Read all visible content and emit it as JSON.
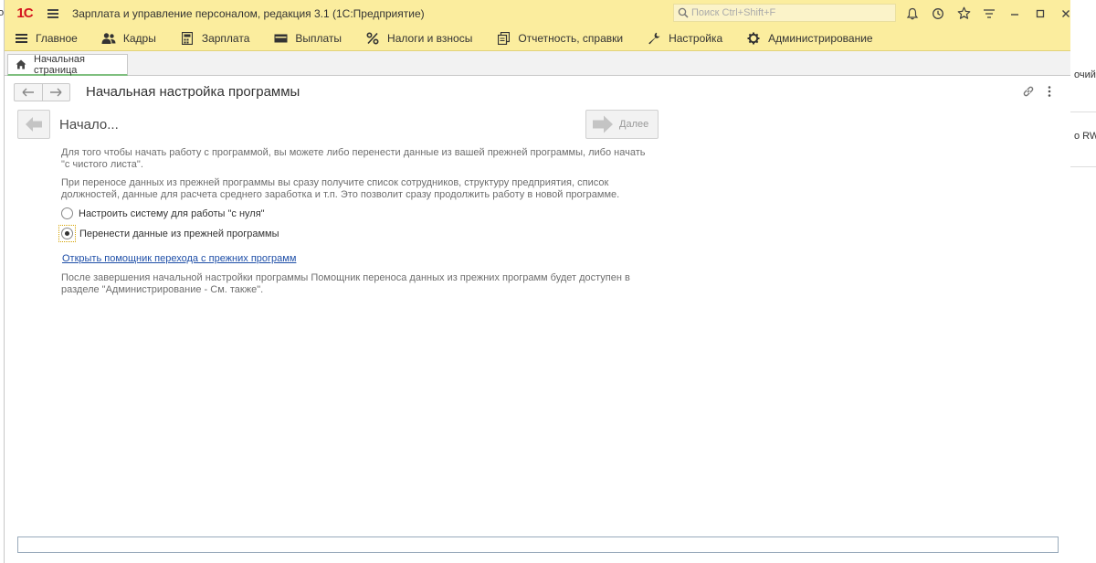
{
  "background": {
    "left_text": "о",
    "right_text_1": "очий с",
    "right_text_2": "о RW д"
  },
  "app": {
    "logo": "1С",
    "title": "Зарплата и управление персоналом, редакция 3.1  (1С:Предприятие)",
    "search_placeholder": "Поиск Ctrl+Shift+F",
    "toolbar_icons": [
      "bell-icon",
      "history-icon",
      "star-icon",
      "menu-lines-icon",
      "minimize-icon",
      "maximize-icon",
      "close-icon"
    ]
  },
  "sections": [
    {
      "label": "Главное",
      "icon": "hamburger-icon"
    },
    {
      "label": "Кадры",
      "icon": "people-icon"
    },
    {
      "label": "Зарплата",
      "icon": "calculator-icon"
    },
    {
      "label": "Выплаты",
      "icon": "wallet-icon"
    },
    {
      "label": "Налоги и взносы",
      "icon": "percent-icon"
    },
    {
      "label": "Отчетность, справки",
      "icon": "documents-icon"
    },
    {
      "label": "Настройка",
      "icon": "wrench-icon"
    },
    {
      "label": "Администрирование",
      "icon": "gear-icon"
    }
  ],
  "tabs": [
    {
      "label": "Начальная страница",
      "icon": "home-icon"
    }
  ],
  "form": {
    "title": "Начальная настройка программы",
    "step_title": "Начало...",
    "next_label": "Далее",
    "intro": "Для того чтобы начать работу с программой, вы можете либо перенести данные из вашей прежней программы, либо начать \"с чистого листа\".",
    "transfer_note": "При переносе данных из прежней программы вы сразу получите список сотрудников, структуру предприятия, список должностей, данные для расчета среднего заработка и т.п. Это позволит сразу продолжить работу в новой программе.",
    "options": [
      {
        "label": "Настроить систему для работы \"с нуля\"",
        "checked": false
      },
      {
        "label": "Перенести данные из прежней программы",
        "checked": true
      }
    ],
    "help_link": "Открыть помощник перехода с прежних программ",
    "after_note": "После завершения начальной настройки программы Помощник переноса данных из прежних программ будет доступен в разделе \"Администрирование - См. также\"."
  },
  "colors": {
    "header_bg": "#fbed9e",
    "logo_red": "#d4141e",
    "link_blue": "#1f4fa8"
  }
}
